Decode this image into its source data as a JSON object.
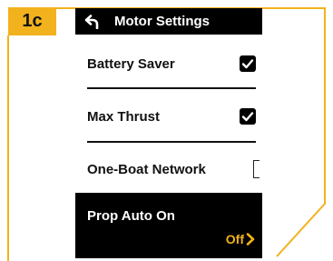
{
  "step_badge": "1c",
  "header": {
    "title": "Motor Settings",
    "back_icon": "back-arrow-icon"
  },
  "settings": [
    {
      "label": "Battery Saver",
      "control": "checkbox",
      "checked": true
    },
    {
      "label": "Max Thrust",
      "control": "checkbox",
      "checked": true
    },
    {
      "label": "One-Boat Network",
      "control": "checkbox",
      "checked": false
    }
  ],
  "selected_item": {
    "label": "Prop Auto On",
    "value": "Off",
    "icon": "chevron-right-icon"
  },
  "colors": {
    "accent": "#f2b21d",
    "screen_bg": "#ffffff",
    "bar_bg": "#000000",
    "text": "#111111"
  }
}
